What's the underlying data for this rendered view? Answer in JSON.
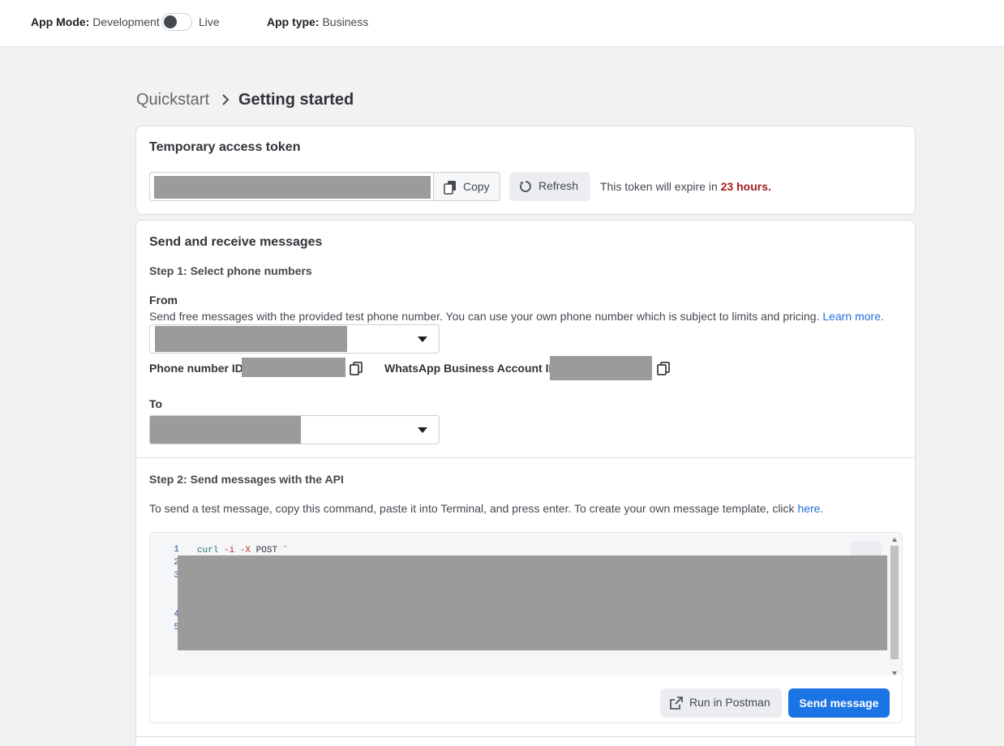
{
  "topbar": {
    "app_mode_label": "App Mode:",
    "app_mode_value": "Development",
    "live_label": "Live",
    "app_type_label": "App type:",
    "app_type_value": "Business"
  },
  "breadcrumb": {
    "parent": "Quickstart",
    "current": "Getting started"
  },
  "token_card": {
    "title": "Temporary access token",
    "copy_label": "Copy",
    "refresh_label": "Refresh",
    "expiry_prefix": "This token will expire in",
    "expiry_value": "23 hours."
  },
  "messages_card": {
    "title": "Send and receive messages",
    "step1": "Step 1: Select phone numbers",
    "from_label": "From",
    "from_desc": "Send free messages with the provided test phone number. You can use your own phone number which is subject to limits and pricing.",
    "learn_more": "Learn more.",
    "phone_id_label": "Phone number ID:",
    "waba_id_label": "WhatsApp Business Account ID:",
    "to_label": "To",
    "step2": "Step 2: Send messages with the API",
    "step2_desc": "To send a test message, copy this command, paste it into Terminal, and press enter. To create your own message template, click",
    "here_link": "here.",
    "code": {
      "line_numbers": [
        "1",
        "2",
        "3",
        "4",
        "5"
      ],
      "line1_cmd": "curl",
      "line1_flag1": "-i",
      "line1_flag2": "-X",
      "line1_rest": "POST `"
    },
    "postman_label": "Run in Postman",
    "send_label": "Send message"
  },
  "colors": {
    "primary": "#1b74e4",
    "link": "#216fdb",
    "expiry": "#a11e1e"
  }
}
